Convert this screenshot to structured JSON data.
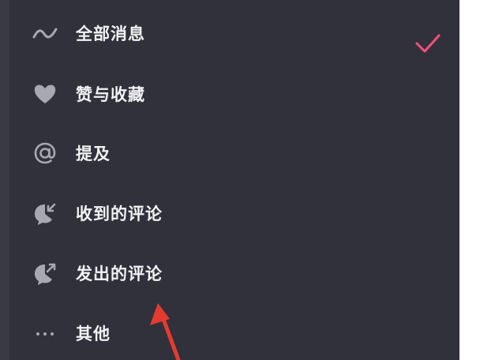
{
  "menu": {
    "items": [
      {
        "label": "全部消息",
        "icon": "wave-icon",
        "selected": true
      },
      {
        "label": "赞与收藏",
        "icon": "heart-icon",
        "selected": false
      },
      {
        "label": "提及",
        "icon": "at-icon",
        "selected": false
      },
      {
        "label": "收到的评论",
        "icon": "comment-received-icon",
        "selected": false
      },
      {
        "label": "发出的评论",
        "icon": "comment-sent-icon",
        "selected": false
      },
      {
        "label": "其他",
        "icon": "more-dots-icon",
        "selected": false
      }
    ]
  },
  "colors": {
    "background": "#30313b",
    "text": "#f2f2f4",
    "icon": "#a7a8b2",
    "check": "#ff4f78",
    "annotation_arrow": "#e53b2f"
  }
}
